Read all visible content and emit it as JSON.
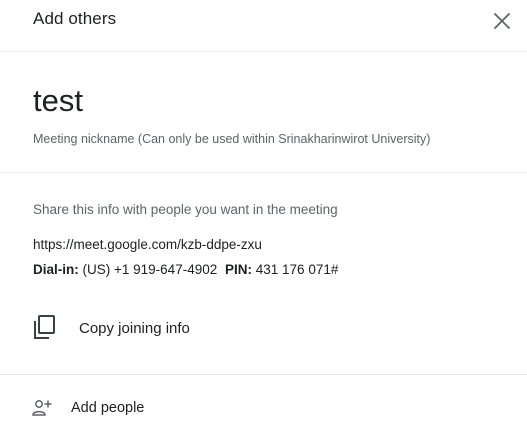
{
  "dialog": {
    "title": "Add others",
    "close_icon": "close-icon"
  },
  "meeting": {
    "nickname": "test",
    "caption": "Meeting nickname (Can only be used within Srinakharinwirot University)"
  },
  "share": {
    "hint": "Share this info with people you want in the meeting",
    "link": "https://meet.google.com/kzb-ddpe-zxu",
    "dial_in_label": "Dial-in:",
    "dial_in_number": "(US) +1 919-647-4902",
    "pin_label": "PIN:",
    "pin_value": "431 176 071#"
  },
  "actions": {
    "copy_label": "Copy joining info",
    "copy_icon": "copy-icon",
    "add_people_label": "Add people",
    "add_people_icon": "add-person-icon"
  }
}
